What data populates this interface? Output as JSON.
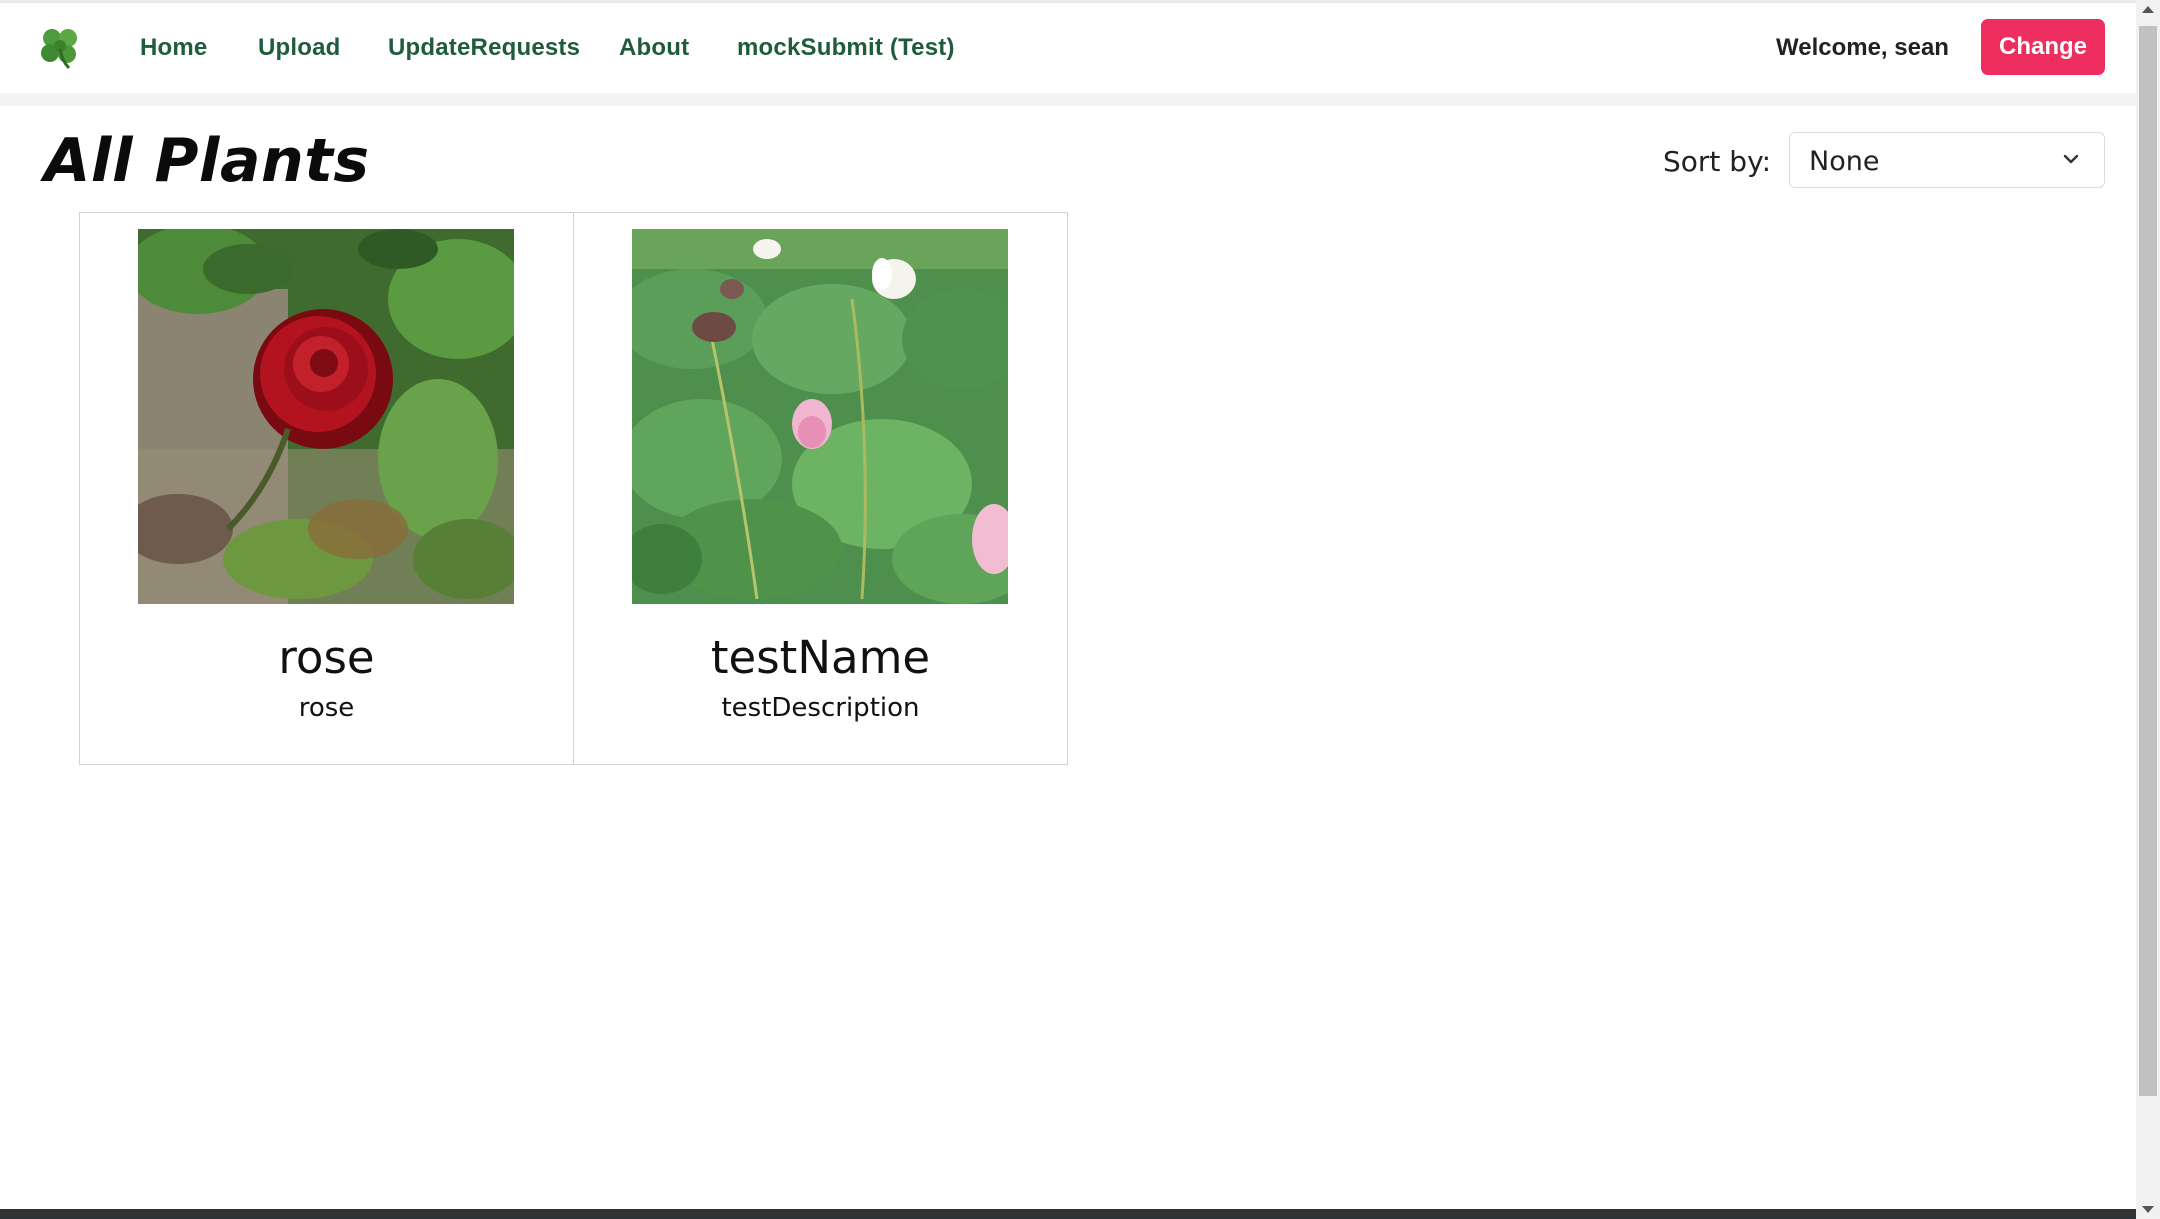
{
  "navbar": {
    "logo_icon": "shamrock-icon",
    "links": [
      "Home",
      "Upload",
      "UpdateRequests",
      "About",
      "mockSubmit (Test)"
    ],
    "welcome_text": "Welcome, sean",
    "change_label": "Change",
    "link_color": "#1f5c3e",
    "button_color": "#ee2e5f"
  },
  "main": {
    "title": "All Plants",
    "sort": {
      "label": "Sort by:",
      "selected": "None",
      "icon": "chevron-down-icon"
    }
  },
  "plants": [
    {
      "name": "rose",
      "description": "rose",
      "image": "red-rose-photo"
    },
    {
      "name": "testName",
      "description": "testDescription",
      "image": "lotus-pond-photo"
    }
  ]
}
